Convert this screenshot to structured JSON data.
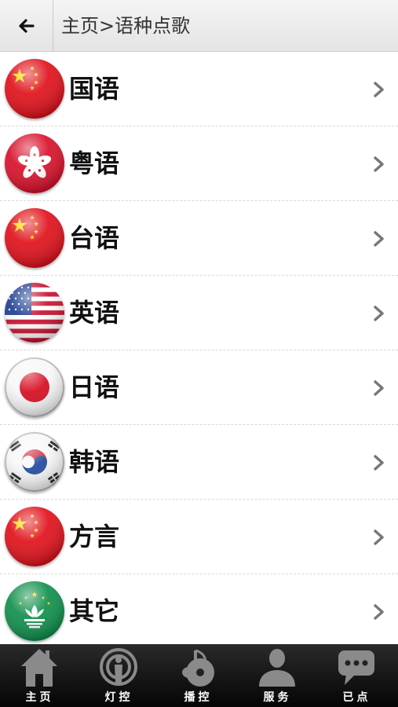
{
  "header": {
    "title": "主页>语种点歌",
    "back_icon": "arrow-left-icon"
  },
  "languages": [
    {
      "label": "国语",
      "flag": "china-flag-icon"
    },
    {
      "label": "粤语",
      "flag": "hong-kong-flag-icon"
    },
    {
      "label": "台语",
      "flag": "china-flag-icon"
    },
    {
      "label": "英语",
      "flag": "usa-flag-icon"
    },
    {
      "label": "日语",
      "flag": "japan-flag-icon"
    },
    {
      "label": "韩语",
      "flag": "korea-flag-icon"
    },
    {
      "label": "方言",
      "flag": "china-flag-icon"
    },
    {
      "label": "其它",
      "flag": "macau-flag-icon"
    }
  ],
  "tabbar": [
    {
      "label": "主页",
      "icon": "home-icon"
    },
    {
      "label": "灯控",
      "icon": "light-control-icon"
    },
    {
      "label": "播控",
      "icon": "playback-control-icon"
    },
    {
      "label": "服务",
      "icon": "service-person-icon"
    },
    {
      "label": "已点",
      "icon": "chat-bubble-icon"
    }
  ]
}
